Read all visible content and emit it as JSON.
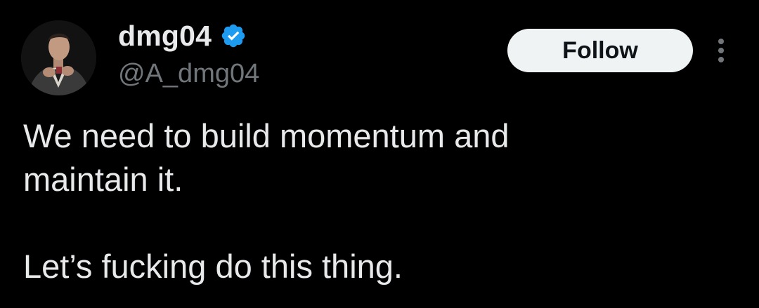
{
  "theme": {
    "background": "#000000",
    "text_primary": "#e7e9ea",
    "text_secondary": "#71767b",
    "verified_color": "#1d9bf0",
    "follow_bg": "#eff3f4",
    "follow_text": "#0f1419"
  },
  "author": {
    "display_name": "dmg04",
    "handle": "@A_dmg04",
    "verified_icon": "verified-badge-icon",
    "avatar_icon": "avatar"
  },
  "actions": {
    "follow_label": "Follow",
    "more_icon": "more-options-icon"
  },
  "tweet": {
    "paragraph_1": "We need to build momentum and\nmaintain it.",
    "paragraph_2": "Let’s fucking do this thing."
  }
}
